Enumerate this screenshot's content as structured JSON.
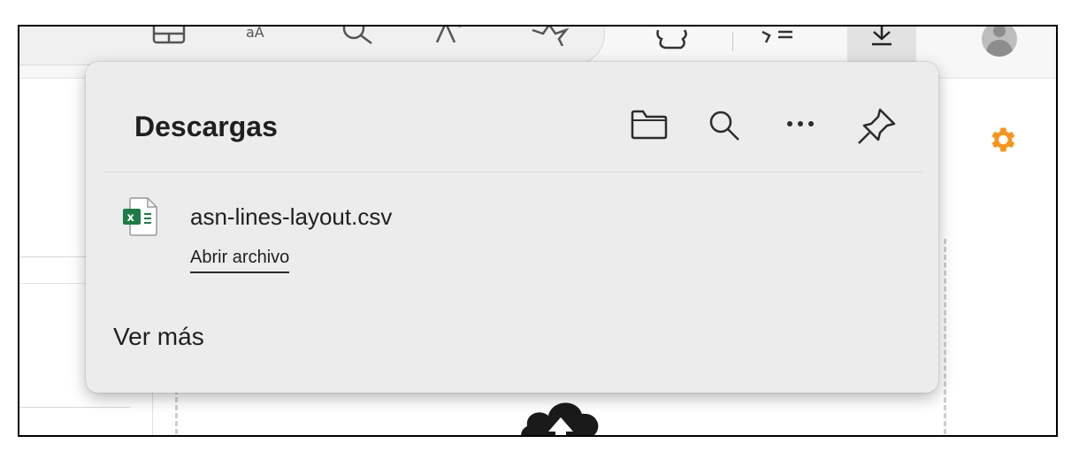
{
  "toolbar": {
    "icons": [
      "split-screen-icon",
      "read-aloud-icon",
      "search-icon",
      "text-size-icon",
      "favorite-star-icon",
      "extensions-icon",
      "favorites-list-icon",
      "download-icon",
      "profile-avatar-icon"
    ]
  },
  "panel": {
    "title": "Descargas",
    "header_icons": [
      "folder-icon",
      "search-icon",
      "more-options-icon",
      "pin-icon"
    ],
    "file": {
      "name": "asn-lines-layout.csv",
      "action": "Abrir archivo",
      "icon": "excel-file-icon"
    },
    "see_more": "Ver más"
  },
  "page": {
    "settings_icon": "gear-icon",
    "upload_icon": "cloud-upload-icon"
  },
  "colors": {
    "panel_bg": "#ececec",
    "gear": "#f7941d",
    "excel_green": "#1e7b45"
  }
}
